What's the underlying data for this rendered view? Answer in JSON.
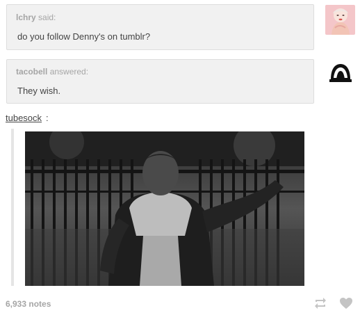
{
  "question": {
    "asker": "lchry",
    "asker_suffix": "said:",
    "text": "do you follow Denny's on tumblr?"
  },
  "answer": {
    "answerer": "tacobell",
    "answerer_suffix": "answered:",
    "text": "They wish."
  },
  "reblog": {
    "username": "tubesock",
    "colon": ":"
  },
  "footer": {
    "notes": "6,933 notes"
  },
  "icons": {
    "reblog": "reblog-icon",
    "like": "heart-icon"
  },
  "colors": {
    "bubble_bg": "#f1f1f1",
    "muted_text": "#a5a5a5",
    "body_text": "#444444",
    "footer_icon": "#c4c4c4"
  }
}
